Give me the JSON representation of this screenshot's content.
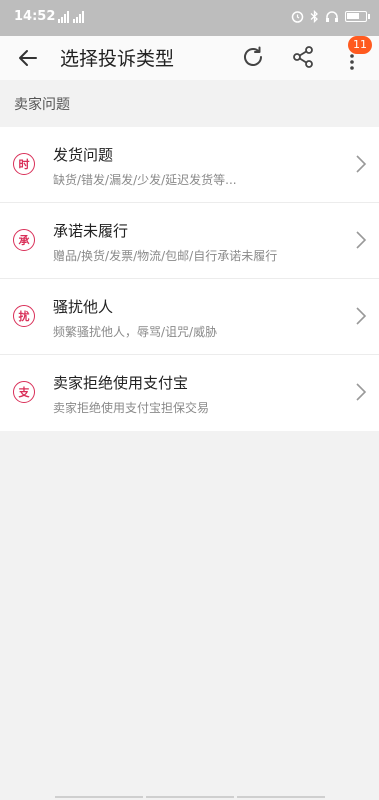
{
  "status_bar": {
    "time": "14:52",
    "icons": [
      "signal-icon",
      "signal-icon",
      "alarm-icon",
      "bluetooth-icon",
      "headphones-icon",
      "battery-icon"
    ]
  },
  "header": {
    "title": "选择投诉类型",
    "notification_count": "11",
    "icons": [
      "back-arrow-icon",
      "refresh-icon",
      "share-icon",
      "more-vertical-icon"
    ]
  },
  "section": {
    "title": "卖家问题"
  },
  "items": [
    {
      "icon_text": "时",
      "title": "发货问题",
      "desc": "缺货/错发/漏发/少发/延迟发货等..."
    },
    {
      "icon_text": "承",
      "title": "承诺未履行",
      "desc": "赠品/换货/发票/物流/包邮/自行承诺未履行"
    },
    {
      "icon_text": "扰",
      "title": "骚扰他人",
      "desc": "频繁骚扰他人，辱骂/诅咒/威胁"
    },
    {
      "icon_text": "支",
      "title": "卖家拒绝使用支付宝",
      "desc": "卖家拒绝使用支付宝担保交易"
    }
  ],
  "colors": {
    "accent": "#d92f58",
    "badge": "#ff5a1f",
    "status_bar": "#bdbdbd"
  }
}
